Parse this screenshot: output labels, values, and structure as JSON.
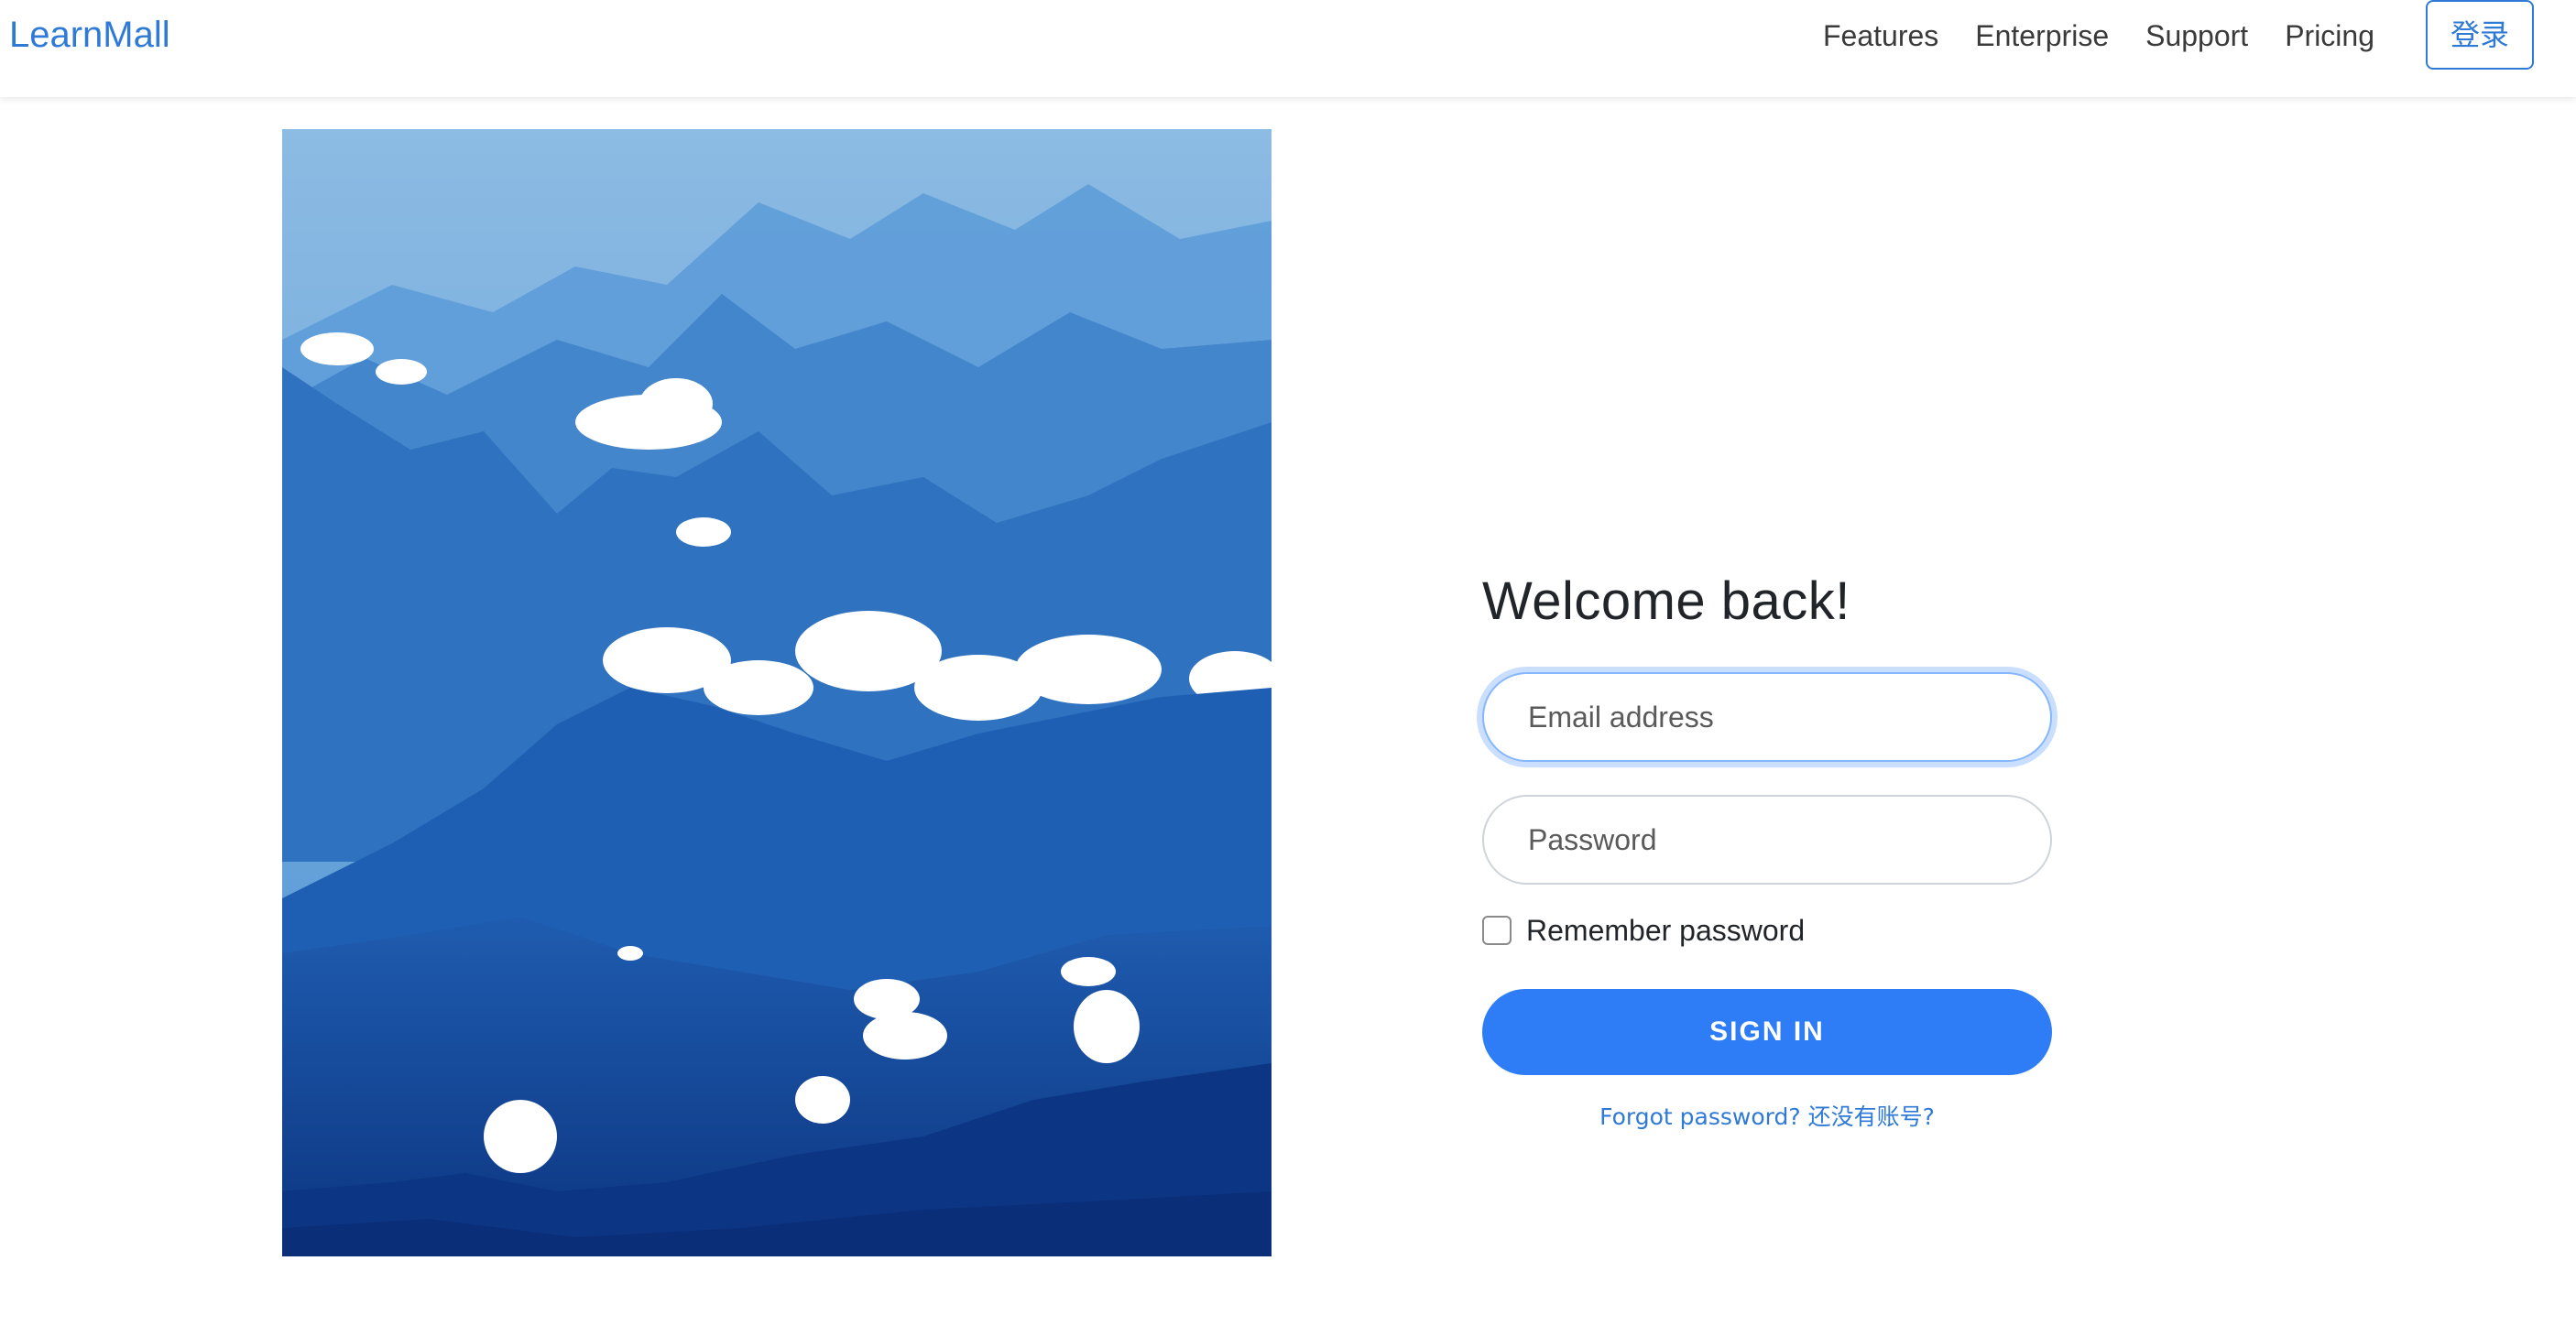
{
  "navbar": {
    "brand": "LearnMall",
    "links": [
      "Features",
      "Enterprise",
      "Support",
      "Pricing"
    ],
    "login_label": "登录"
  },
  "hero_image": {
    "description_icon": "mountain-landscape-image",
    "colors": {
      "sky": "#7fb3e0",
      "far": "#3f86cf",
      "mid": "#2a6fc0",
      "near": "#1a4ea3",
      "front": "#0e3a8a",
      "cloud": "#ffffff"
    }
  },
  "login_form": {
    "heading": "Welcome back!",
    "email_placeholder": "Email address",
    "email_value": "",
    "password_placeholder": "Password",
    "password_value": "",
    "remember_label": "Remember password",
    "remember_checked": false,
    "submit_label": "SIGN IN",
    "forgot_link": "Forgot password?",
    "signup_link": "还没有账号?"
  },
  "colors": {
    "accent": "#2e7cf6",
    "brand": "#2f7ad6",
    "focus_ring": "#86b7fe"
  }
}
